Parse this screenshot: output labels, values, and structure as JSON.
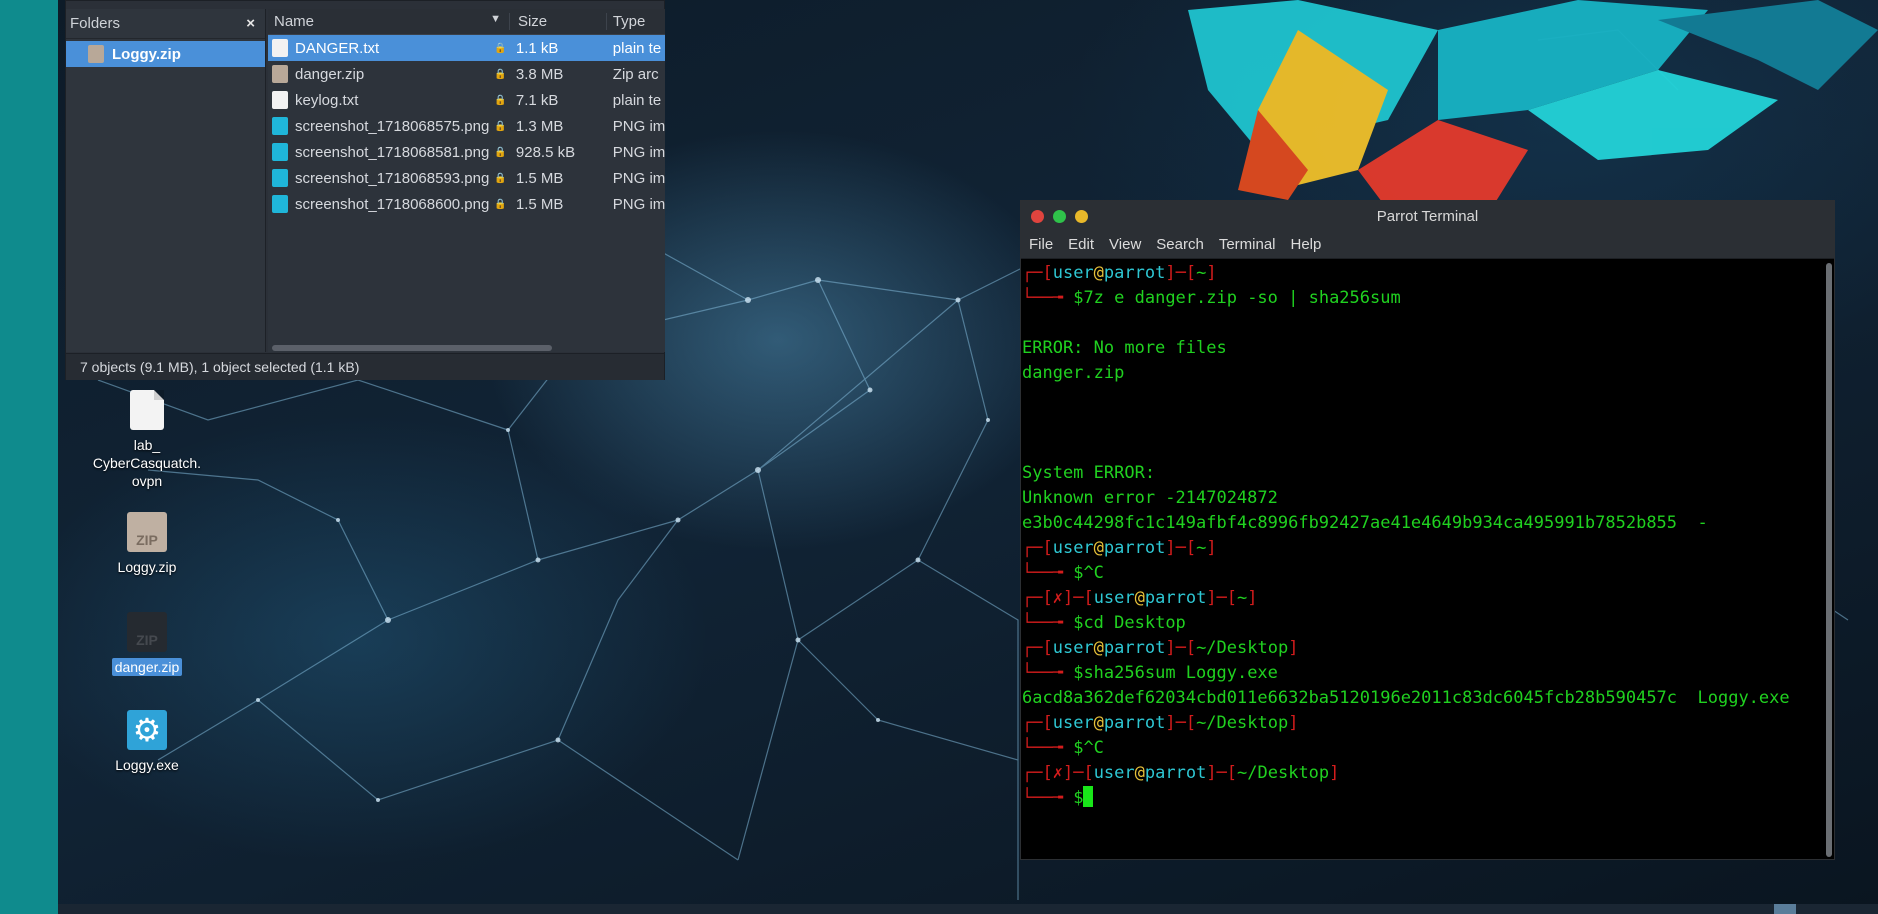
{
  "file_manager": {
    "folders_header": "Folders",
    "close_symbol": "×",
    "selected_folder": "Loggy.zip",
    "columns": {
      "name": "Name",
      "size": "Size",
      "type": "Type"
    },
    "files": [
      {
        "name": "DANGER.txt",
        "size": "1.1 kB",
        "type": "plain te",
        "icon": "text-file-icon",
        "selected": true
      },
      {
        "name": "danger.zip",
        "size": "3.8 MB",
        "type": "Zip arc",
        "icon": "zip-file-icon",
        "selected": false
      },
      {
        "name": "keylog.txt",
        "size": "7.1 kB",
        "type": "plain te",
        "icon": "text-file-icon",
        "selected": false
      },
      {
        "name": "screenshot_1718068575.png",
        "size": "1.3 MB",
        "type": "PNG im",
        "icon": "image-file-icon",
        "selected": false
      },
      {
        "name": "screenshot_1718068581.png",
        "size": "928.5 kB",
        "type": "PNG im",
        "icon": "image-file-icon",
        "selected": false
      },
      {
        "name": "screenshot_1718068593.png",
        "size": "1.5 MB",
        "type": "PNG im",
        "icon": "image-file-icon",
        "selected": false
      },
      {
        "name": "screenshot_1718068600.png",
        "size": "1.5 MB",
        "type": "PNG im",
        "icon": "image-file-icon",
        "selected": false
      }
    ],
    "status": "7 objects (9.1 MB), 1 object selected (1.1 kB)"
  },
  "desktop_icons": [
    {
      "label_lines": [
        "lab_",
        "CyberCasquatch.",
        "ovpn"
      ],
      "icon": "document-icon"
    },
    {
      "label": "Loggy.zip",
      "icon_text": "ZIP",
      "icon": "zip-icon"
    },
    {
      "label": "danger.zip",
      "icon_text": "ZIP",
      "icon": "zip-icon",
      "selected": true
    },
    {
      "label": "Loggy.exe",
      "icon_text": "⚙",
      "icon": "gear-icon"
    }
  ],
  "terminal": {
    "title": "Parrot Terminal",
    "menu": [
      "File",
      "Edit",
      "View",
      "Search",
      "Terminal",
      "Help"
    ],
    "user": "user",
    "host": "parrot",
    "x_mark": "✗",
    "cwd_home": "~",
    "cwd_desktop": "~/Desktop",
    "cmd1": "7z e danger.zip -so | sha256sum",
    "out_error": "ERROR: No more files",
    "out_file": "danger.zip",
    "out_sys_error": "System ERROR:",
    "out_unknown": "Unknown error -2147024872",
    "out_hash1": "e3b0c44298fc1c149afbf4c8996fb92427ae41e4649b934ca495991b7852b855  -",
    "cmd_ctrl_c": "^C",
    "cmd_cd": "cd Desktop",
    "cmd_sha": "sha256sum Loggy.exe",
    "out_hash2": "6acd8a362def62034cbd011e6632ba5120196e2011c83dc6045fcb28b590457c  Loggy.exe"
  },
  "colors": {
    "selection_blue": "#4a90d9",
    "terminal_green": "#20d120",
    "prompt_red": "#d31c1c",
    "prompt_cyan": "#2ec7d3",
    "at_yellow": "#e8c23a"
  }
}
